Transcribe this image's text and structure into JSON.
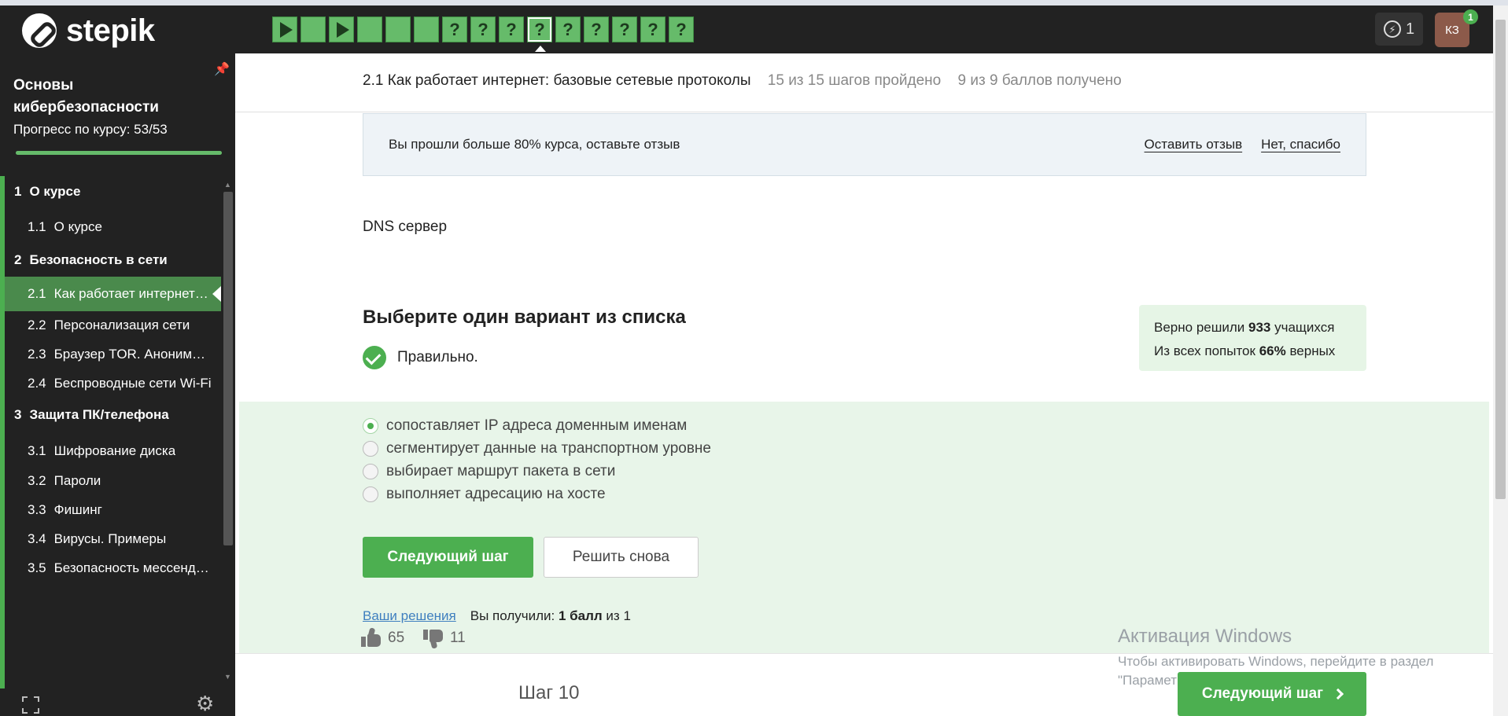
{
  "navbar": {
    "logo_text": "stepik",
    "steps": [
      {
        "kind": "play"
      },
      {
        "kind": "text",
        "label": ""
      },
      {
        "kind": "play"
      },
      {
        "kind": "text",
        "label": ""
      },
      {
        "kind": "text",
        "label": ""
      },
      {
        "kind": "text",
        "label": ""
      },
      {
        "kind": "text",
        "label": "?"
      },
      {
        "kind": "text",
        "label": "?"
      },
      {
        "kind": "text",
        "label": "?"
      },
      {
        "kind": "text",
        "label": "?",
        "active": true
      },
      {
        "kind": "text",
        "label": "?"
      },
      {
        "kind": "text",
        "label": "?"
      },
      {
        "kind": "text",
        "label": "?"
      },
      {
        "kind": "text",
        "label": "?"
      },
      {
        "kind": "text",
        "label": "?"
      }
    ],
    "energy_count": "1",
    "avatar_initials": "КЗ",
    "notification_count": "1"
  },
  "sidebar": {
    "course_title": "Основы кибербезопасности",
    "progress_label": "Прогресс по курсу:  53/53",
    "progress": 1.0,
    "toc": [
      {
        "type": "section",
        "num": "1",
        "label": "О курсе"
      },
      {
        "type": "lesson",
        "num": "1.1",
        "label": "О курсе"
      },
      {
        "type": "section",
        "num": "2",
        "label": "Безопасность в сети"
      },
      {
        "type": "lesson",
        "num": "2.1",
        "label": "Как работает интернет: базовые сетевые протоколы",
        "active": true
      },
      {
        "type": "lesson",
        "num": "2.2",
        "label": "Персонализация сети"
      },
      {
        "type": "lesson",
        "num": "2.3",
        "label": "Браузер TOR. Анонимность"
      },
      {
        "type": "lesson",
        "num": "2.4",
        "label": "Беспроводные сети Wi-Fi"
      },
      {
        "type": "section",
        "num": "3",
        "label": "Защита ПК/телефона"
      },
      {
        "type": "lesson",
        "num": "3.1",
        "label": "Шифрование диска"
      },
      {
        "type": "lesson",
        "num": "3.2",
        "label": "Пароли"
      },
      {
        "type": "lesson",
        "num": "3.3",
        "label": "Фишинг"
      },
      {
        "type": "lesson",
        "num": "3.4",
        "label": "Вирусы. Примеры"
      },
      {
        "type": "lesson",
        "num": "3.5",
        "label": "Безопасность мессенджеров"
      }
    ]
  },
  "lesson": {
    "title": "2.1 Как работает интернет: базовые сетевые протоколы",
    "steps_passed": "15 из 15 шагов пройдено",
    "points": "9 из 9 баллов  получено"
  },
  "review_banner": {
    "message": "Вы прошли больше 80% курса, оставьте отзыв",
    "leave_review": "Оставить отзыв",
    "no_thanks": "Нет, спасибо"
  },
  "step_content": {
    "text": "DNS сервер"
  },
  "quiz": {
    "title": "Выберите один вариант из списка",
    "result": "Правильно.",
    "stats_line1_prefix": "Верно решили ",
    "stats_line1_count": "933",
    "stats_line1_suffix": " учащихся",
    "stats_line2_prefix": "Из всех попыток ",
    "stats_line2_percent": "66%",
    "stats_line2_suffix": " верных",
    "options": [
      {
        "label": "сопоставляет IP адреса доменным именам",
        "checked": true
      },
      {
        "label": "сегментирует данные на транспортном уровне",
        "checked": false
      },
      {
        "label": "выбирает маршрут пакета в сети",
        "checked": false
      },
      {
        "label": "выполняет адресацию на хосте",
        "checked": false
      }
    ],
    "next_button": "Следующий шаг",
    "retry_button": "Решить снова",
    "solutions_link": "Ваши решения",
    "score_prefix": "Вы получили: ",
    "score_value": "1 балл",
    "score_mid": " из ",
    "score_total": "1"
  },
  "footer": {
    "likes": "65",
    "dislikes": "11",
    "step_label": "Шаг 10",
    "next_button": "Следующий шаг"
  },
  "watermark": {
    "title": "Активация Windows",
    "line1": "Чтобы активировать Windows, перейдите в раздел",
    "line2": "\"Параметры\"."
  },
  "colors": {
    "accent": "#4caf50",
    "dark_bg": "#222222",
    "answer_bg": "#e8f5e9",
    "link": "#3f7fbf"
  }
}
